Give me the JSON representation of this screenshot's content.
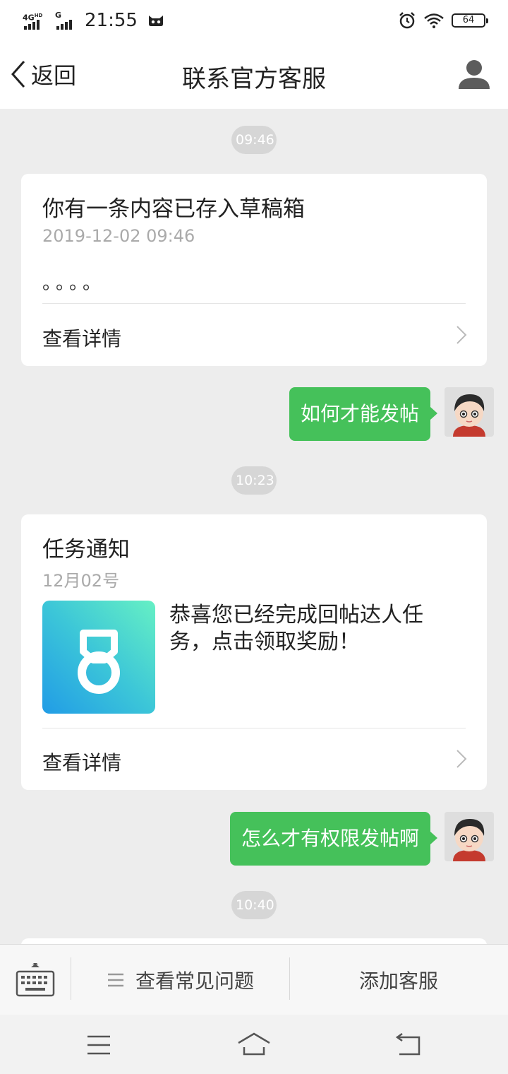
{
  "status_bar": {
    "network_label": "4G",
    "network_suffix": "HD",
    "network2_label": "G",
    "time": "21:55",
    "battery": "64"
  },
  "header": {
    "back_label": "返回",
    "title": "联系官方客服"
  },
  "messages": {
    "time1": "09:46",
    "draft_card": {
      "title": "你有一条内容已存入草稿箱",
      "date": "2019-12-02 09:46",
      "body": "。。。。",
      "link": "查看详情"
    },
    "user_msg1": "如何才能发帖",
    "time2": "10:23",
    "task_card": {
      "title": "任务通知",
      "date": "12月02号",
      "text": "恭喜您已经完成回帖达人任务，点击领取奖励！",
      "link": "查看详情"
    },
    "user_msg2": "怎么才有权限发帖啊",
    "time3": "10:40"
  },
  "bottom_bar": {
    "faq_label": "查看常见问题",
    "add_service_label": "添加客服"
  },
  "icons": {
    "keyboard": "keyboard-icon",
    "menu": "menu-icon",
    "home": "home-icon",
    "back": "back-arrow-icon"
  },
  "colors": {
    "accent_green": "#45c15a",
    "time_pill": "#d6d6d6",
    "background": "#ededed"
  }
}
